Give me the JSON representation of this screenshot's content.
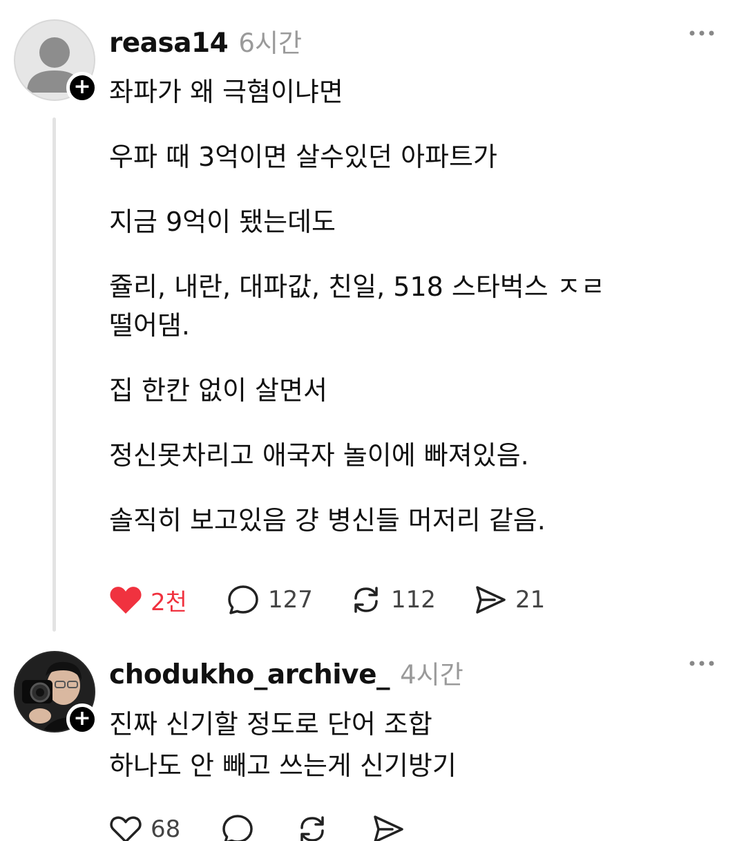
{
  "posts": [
    {
      "username": "reasa14",
      "time": "6시간",
      "lines": [
        "좌파가 왜 극혐이냐면",
        "우파 때 3억이면 살수있던 아파트가",
        "지금 9억이 됐는데도",
        "쥴리, 내란, 대파값, 친일, 518 스타벅스 ㅈㄹ",
        "떨어댐.",
        "집 한칸 없이 살면서",
        "정신못차리고 애국자 놀이에 빠져있음.",
        "솔직히 보고있음 걍 병신들 머저리 같음."
      ],
      "actions": {
        "likes": "2천",
        "comments": "127",
        "reposts": "112",
        "shares": "21"
      }
    },
    {
      "username": "chodukho_archive_",
      "time": "4시간",
      "lines": [
        "진짜 신기할 정도로 단어 조합",
        "하나도 안 빼고 쓰는게 신기방기"
      ],
      "actions": {
        "likes": "68"
      }
    }
  ],
  "icons": {
    "like": "heart-icon",
    "comment": "comment-bubble-icon",
    "repost": "repost-icon",
    "share": "send-icon",
    "more": "more-dots-icon",
    "follow": "plus-icon"
  },
  "colors": {
    "liked": "#f0323f",
    "muted": "#9a9a9a",
    "thread": "#e3e3e3"
  },
  "badge": {
    "plus": "+"
  }
}
